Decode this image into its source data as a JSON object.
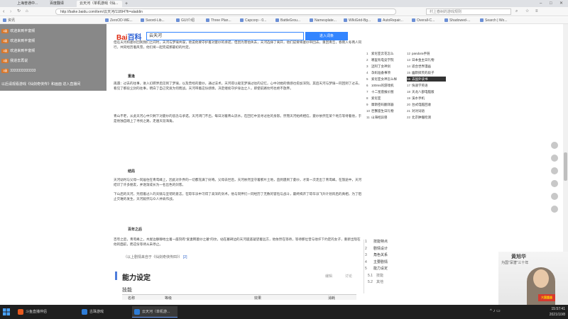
{
  "browser": {
    "tabs": [
      {
        "label": "上海普通中...",
        "active": false
      },
      {
        "label": "百度翻译",
        "active": false
      },
      {
        "label": "云天河（单机游戏《仙...",
        "active": true
      }
    ],
    "address": "http://baike.baidu.com/item/云天河/11894?fr=aladdin",
    "search_placeholder": "村上春树的游戏规则"
  },
  "bookmarks": [
    "资讯",
    "ZeroOD-WE...",
    "Sword-Lib...",
    "GUI介绍",
    "Three Plan...",
    "Capcorp - 0...",
    "BattleGrou...",
    "Namesplate...",
    "WIkiGrid-Bg...",
    "AutoRepair...",
    "Overall-C...",
    "Shadowed-...",
    "Search | Wo..."
  ],
  "overlay": {
    "lines": [
      {
        "badge": "1级",
        "text": "欢迎来到丰富频"
      },
      {
        "badge": "1级",
        "text": "欢迎来到丰富频"
      },
      {
        "badge": "1级",
        "text": "欢迎来到丰富频"
      },
      {
        "badge": "1级",
        "text": "我进去再说"
      },
      {
        "badge": "1级",
        "text": "3333333333333"
      }
    ],
    "footer": "以后请观看游戏《仙剑奇侠传》和画面 进入直播间"
  },
  "baidu": {
    "logo_a": "Bai",
    "logo_b": "百科",
    "query": "云天河",
    "enter_label": "进入词条"
  },
  "article": {
    "paragraphs": [
      "但在天河和菱纱回到我们之间时，天河与梦璃共谋，他说他要守护着对菱纱的承诺，但因为害怕失去，天河选择了离开，他们说要将菱纱带回去，重回青峦，春雨入冬两人同行，共同经历着风雪，他们将一起完成那最初的约定。",
      "再遇：过去的往事，进入幻瞑界后见到了梦璃，以及曾经的菱纱。通过法术，天河得以窥见梦璃过往的记忆，心中对她的情感也愈加深刻。其后天河与梦璃一同回到了过去，看见了那段尘封的往事，明白了自己究竟为何而战。天河带着这份感情，决定继续守护身边之人，即使前路坎坷也绝不放弃。",
      "青山不老，从此天河心中只剩下对菱纱的思念与承诺。天河闭门不出，每日对着青山流水，在回忆中追寻过往的身影。然而天河始终相信，菱纱依然在某个地方等待着他，于是他独自踏上了寻找之路，走遍天涯海角。",
      "天河幼时与父母一同居住在青鸾峰上，因此对外界的一切都充满了好奇。父母去世后，天河依然坚守着那片土地，直到遇到了菱纱，才第一次走出了青鸾峰。在旅途中，天河结识了许多朋友，并逐渐成长为一名出色的剑客。",
      "下山后的天河，凭借着过人的天赋与坚韧的意志，在琼华派中习得了高深的剑术。他与同伴们一同经历了无数的冒险与战斗，最终揭开了琼华派飞升计划背后的真相，为了阻止灾难的发生，天河毅然与众人并肩作战。",
      "百年之后，青鸾峰上，木屋边静静地立着一座刻有“爱妻韩菱纱之墓”的坟，站在墓碑边的天河遥遥凝望着远方，他依然在等待，等待那位曾与他许下约定的女子，重新出现在他的面前，而这份等待从未停止。"
    ],
    "subheads": [
      "重逢",
      "结局",
      "百年之后"
    ],
    "caption": "（以上剧情来自于《仙剑奇侠传四》）",
    "caption_ref": "[2]",
    "section_title": "能力设定",
    "section_edit": "编辑",
    "section_discuss": "讨论",
    "skills_label": "技能",
    "table_headers": [
      "名称",
      "等级",
      "效果",
      "消耗"
    ]
  },
  "rank": {
    "items": [
      {
        "n": "1",
        "t": "索尼亚云花怎么",
        "hl": false
      },
      {
        "n": "2",
        "t": "哪里有电竞学院",
        "hl": false
      },
      {
        "n": "3",
        "t": "迈阿丁女神剑",
        "hl": false
      },
      {
        "n": "4",
        "t": "孕妈准备事项",
        "hl": false
      },
      {
        "n": "5",
        "t": "索尼亚女神怎么样",
        "hl": false
      },
      {
        "n": "6",
        "t": "100ms的游戏机",
        "hl": false
      },
      {
        "n": "7",
        "t": "十二星座报价图",
        "hl": false
      },
      {
        "n": "8",
        "t": "索尼亚",
        "hl": false
      },
      {
        "n": "9",
        "t": "摩斯密码翻译器",
        "hl": false
      },
      {
        "n": "10",
        "t": "巨蟹座生日礼物",
        "hl": false
      },
      {
        "n": "11",
        "t": "山海经异兽",
        "hl": false
      },
      {
        "n": "12",
        "t": "pandora手链",
        "hl": false
      },
      {
        "n": "13",
        "t": "日本金主日礼物",
        "hl": false
      },
      {
        "n": "14",
        "t": "适合世界漫画",
        "hl": false
      },
      {
        "n": "15",
        "t": "幽默搞笑的段子",
        "hl": false
      },
      {
        "n": "16",
        "t": "去国外读书",
        "hl": true
      },
      {
        "n": "17",
        "t": "快速学英语",
        "hl": false
      },
      {
        "n": "18",
        "t": "天龙八部电脑版",
        "hl": false
      },
      {
        "n": "19",
        "t": "溪水手机",
        "hl": false
      },
      {
        "n": "20",
        "t": "台式电脑回收",
        "hl": false
      },
      {
        "n": "21",
        "t": "对对词语",
        "hl": false
      },
      {
        "n": "22",
        "t": "北京肿瘤检测",
        "hl": false
      }
    ]
  },
  "toc": {
    "items": [
      {
        "n": "1",
        "t": "技能特点",
        "sub": false
      },
      {
        "n": "2",
        "t": "剧情设计",
        "sub": false
      },
      {
        "n": "3",
        "t": "角色关系",
        "sub": false
      },
      {
        "n": "4",
        "t": "主要剧情",
        "sub": false
      },
      {
        "n": "5",
        "t": "能力设定",
        "sub": false
      },
      {
        "n": "5.1",
        "t": "技能",
        "sub": true
      },
      {
        "n": "5.2",
        "t": "其他",
        "sub": true
      }
    ]
  },
  "webcam": {
    "name": "黄旭华",
    "subtitle": "为国“深潜”三十年",
    "badge": "大国重器"
  },
  "taskbar": {
    "tasks": [
      {
        "label": "斗鱼直播伴侣",
        "active": false,
        "color": "#e85a1f"
      },
      {
        "label": "古珠游戏",
        "active": false,
        "color": "#2e7cd6"
      },
      {
        "label": "云天河（单机游...",
        "active": true,
        "color": "#2e7cd6"
      }
    ],
    "time": "15:57:41",
    "date": "2021/10/8"
  }
}
